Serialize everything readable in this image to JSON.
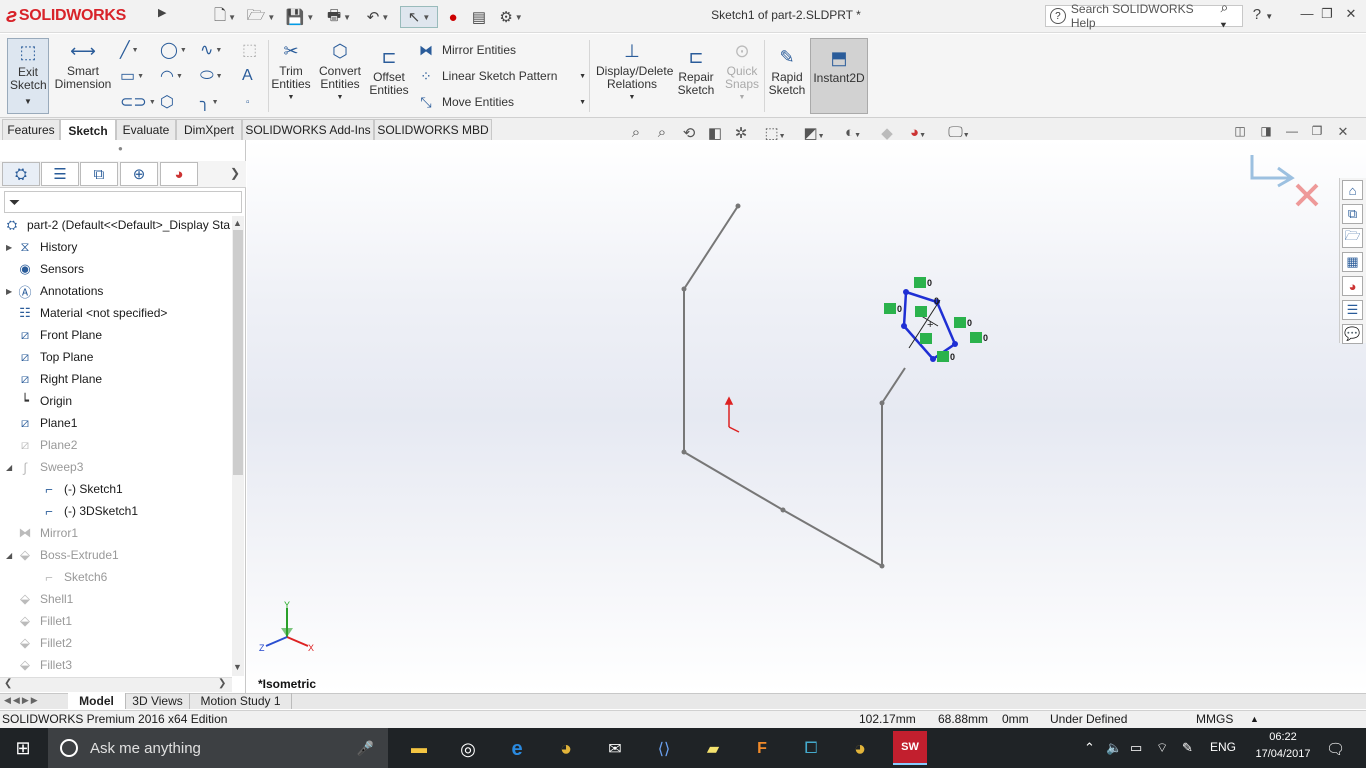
{
  "app": {
    "name": "SOLIDWORKS",
    "title": "Sketch1 of part-2.SLDPRT *"
  },
  "search": {
    "placeholder": "Search SOLIDWORKS Help"
  },
  "ribbon": {
    "exit_sketch": "Exit Sketch",
    "smart_dimension": "Smart Dimension",
    "trim_entities": "Trim Entities",
    "convert_entities": "Convert Entities",
    "offset_entities": "Offset Entities",
    "mirror_entities": "Mirror Entities",
    "linear_sketch_pattern": "Linear Sketch Pattern",
    "move_entities": "Move Entities",
    "display_delete_relations": "Display/Delete Relations",
    "repair_sketch": "Repair Sketch",
    "quick_snaps": "Quick Snaps",
    "rapid_sketch": "Rapid Sketch",
    "instant2d": "Instant2D"
  },
  "tabs": [
    "Features",
    "Sketch",
    "Evaluate",
    "DimXpert",
    "SOLIDWORKS Add-Ins",
    "SOLIDWORKS MBD"
  ],
  "tree": {
    "root": "part-2  (Default<<Default>_Display Sta",
    "items": [
      {
        "label": "History",
        "icon": "history-icon"
      },
      {
        "label": "Sensors",
        "icon": "sensor-icon"
      },
      {
        "label": "Annotations",
        "icon": "annotation-icon"
      },
      {
        "label": "Material <not specified>",
        "icon": "material-icon"
      },
      {
        "label": "Front Plane",
        "icon": "plane-icon"
      },
      {
        "label": "Top Plane",
        "icon": "plane-icon"
      },
      {
        "label": "Right Plane",
        "icon": "plane-icon"
      },
      {
        "label": "Origin",
        "icon": "origin-icon"
      },
      {
        "label": "Plane1",
        "icon": "plane-icon"
      },
      {
        "label": "Plane2",
        "icon": "plane-icon"
      },
      {
        "label": "Sweep3",
        "icon": "sweep-icon"
      },
      {
        "label": "(-) Sketch1",
        "icon": "sketch-icon"
      },
      {
        "label": "(-) 3DSketch1",
        "icon": "3dsketch-icon"
      },
      {
        "label": "Mirror1",
        "icon": "mirror-icon"
      },
      {
        "label": "Boss-Extrude1",
        "icon": "extrude-icon"
      },
      {
        "label": "Sketch6",
        "icon": "sketch-icon"
      },
      {
        "label": "Shell1",
        "icon": "shell-icon"
      },
      {
        "label": "Fillet1",
        "icon": "fillet-icon"
      },
      {
        "label": "Fillet2",
        "icon": "fillet-icon"
      },
      {
        "label": "Fillet3",
        "icon": "fillet-icon"
      }
    ]
  },
  "viewport": {
    "view_label": "*Isometric",
    "triad": {
      "x": "X",
      "y": "Y",
      "z": "Z"
    },
    "relation_tag": "0"
  },
  "bottom_tabs": [
    "Model",
    "3D Views",
    "Motion Study 1"
  ],
  "status": {
    "edition": "SOLIDWORKS Premium 2016 x64 Edition",
    "x": "102.17mm",
    "y": "68.88mm",
    "z": "0mm",
    "state": "Under Defined",
    "units": "MMGS"
  },
  "taskbar": {
    "search": "Ask me anything",
    "lang": "ENG",
    "time": "06:22",
    "date": "17/04/2017"
  }
}
